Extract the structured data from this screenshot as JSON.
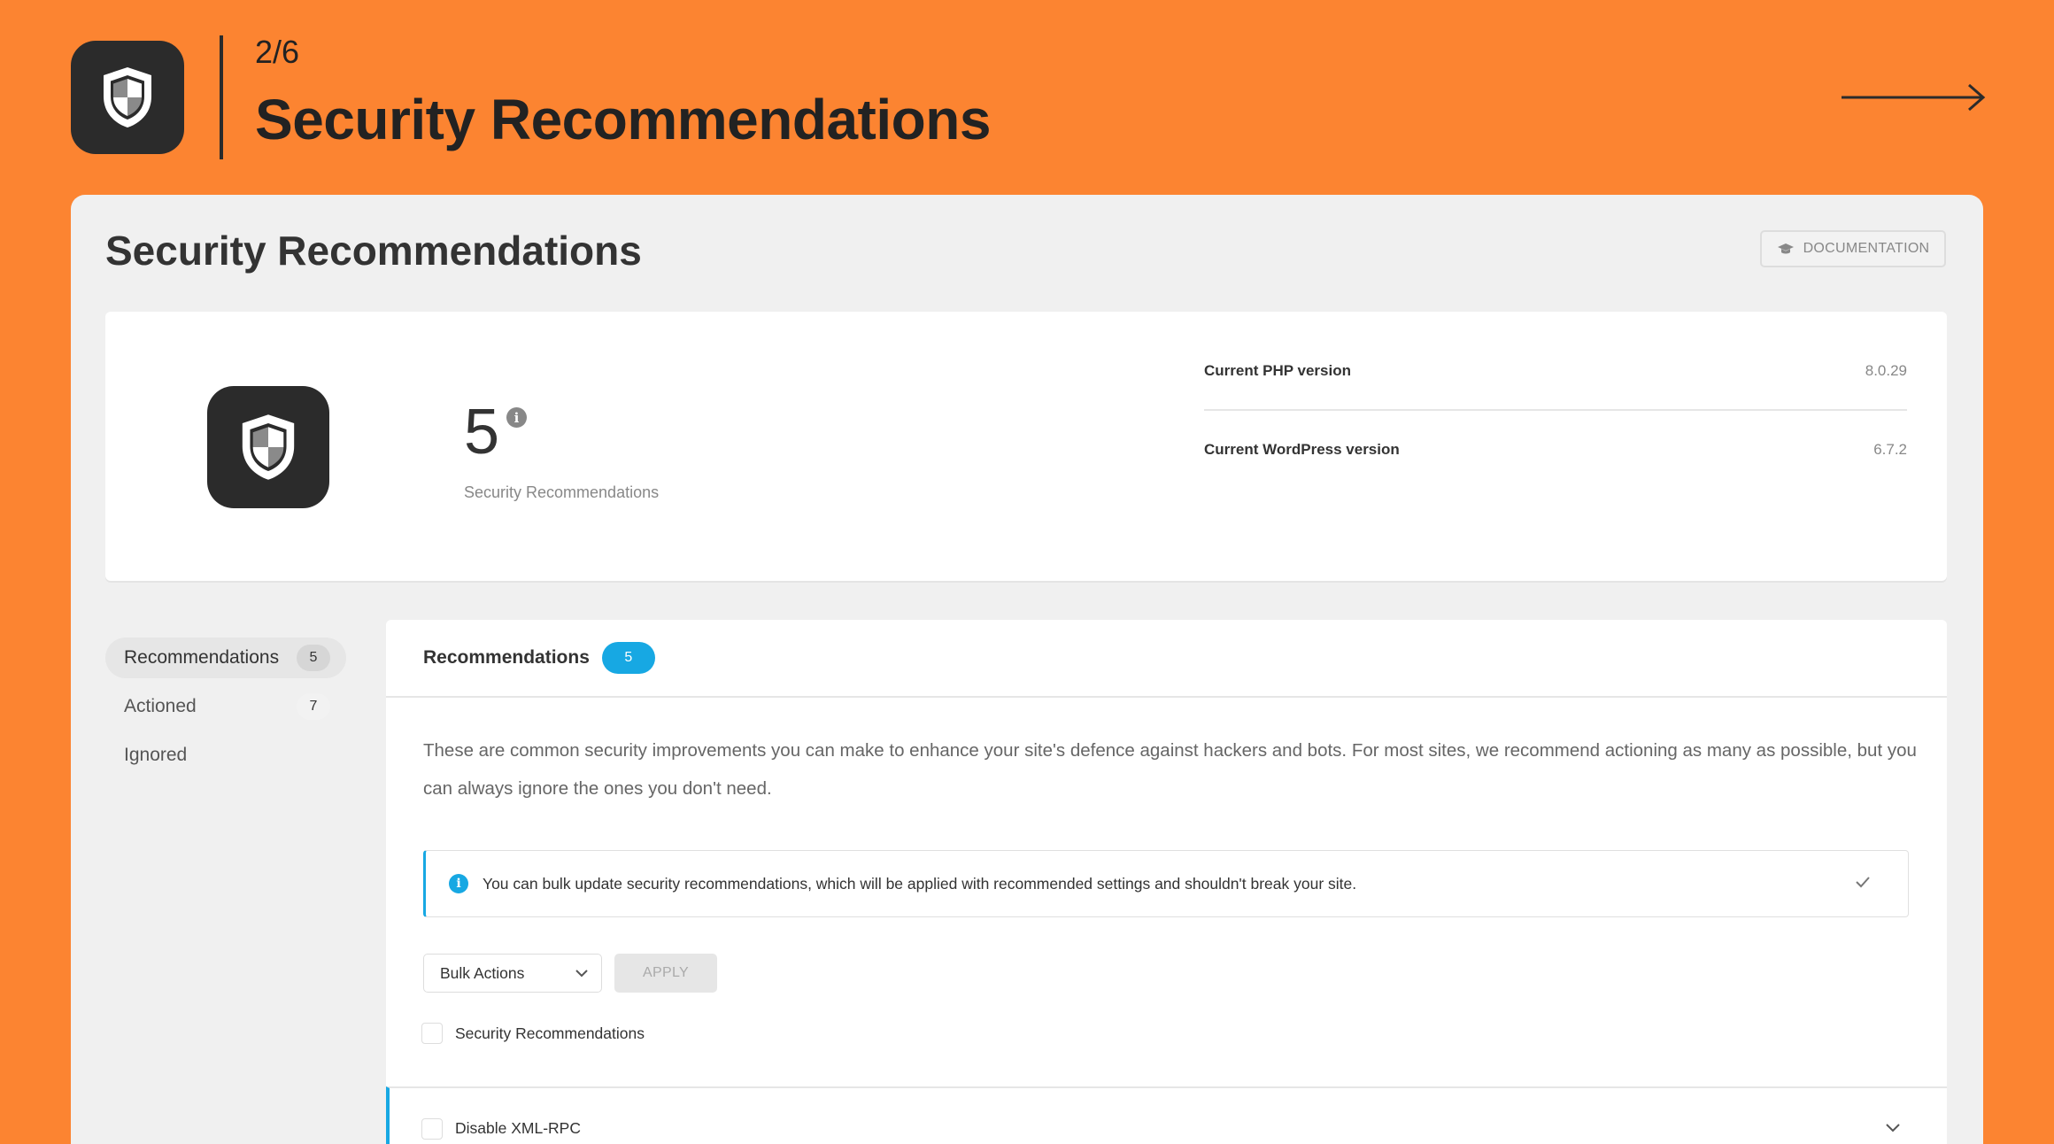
{
  "banner": {
    "step": "2/6",
    "title": "Security Recommendations",
    "icon": "shield-icon",
    "next_icon": "arrow-right-icon"
  },
  "header": {
    "title": "Security Recommendations",
    "documentation_label": "DOCUMENTATION",
    "documentation_icon": "graduation-cap-icon"
  },
  "summary": {
    "count": "5",
    "count_label": "Security Recommendations",
    "versions": [
      {
        "label": "Current PHP version",
        "value": "8.0.29"
      },
      {
        "label": "Current WordPress version",
        "value": "6.7.2"
      }
    ]
  },
  "sidebar": {
    "items": [
      {
        "label": "Recommendations",
        "count": "5",
        "active": true
      },
      {
        "label": "Actioned",
        "count": "7",
        "active": false
      },
      {
        "label": "Ignored",
        "count": "",
        "active": false
      }
    ]
  },
  "content": {
    "title": "Recommendations",
    "count": "5",
    "description": "These are common security improvements you can make to enhance your site's defence against hackers and bots. For most sites, we recommend actioning as many as possible, but you can always ignore the ones you don't need.",
    "notice": "You can bulk update security recommendations, which will be applied with recommended settings and shouldn't break your site.",
    "bulk_actions_label": "Bulk Actions",
    "apply_label": "APPLY",
    "select_all_label": "Security Recommendations",
    "rows": [
      {
        "label": "Disable XML-RPC"
      }
    ]
  },
  "colors": {
    "background": "#fc8431",
    "accent": "#17a8e3",
    "dark": "#2b2b2b"
  }
}
